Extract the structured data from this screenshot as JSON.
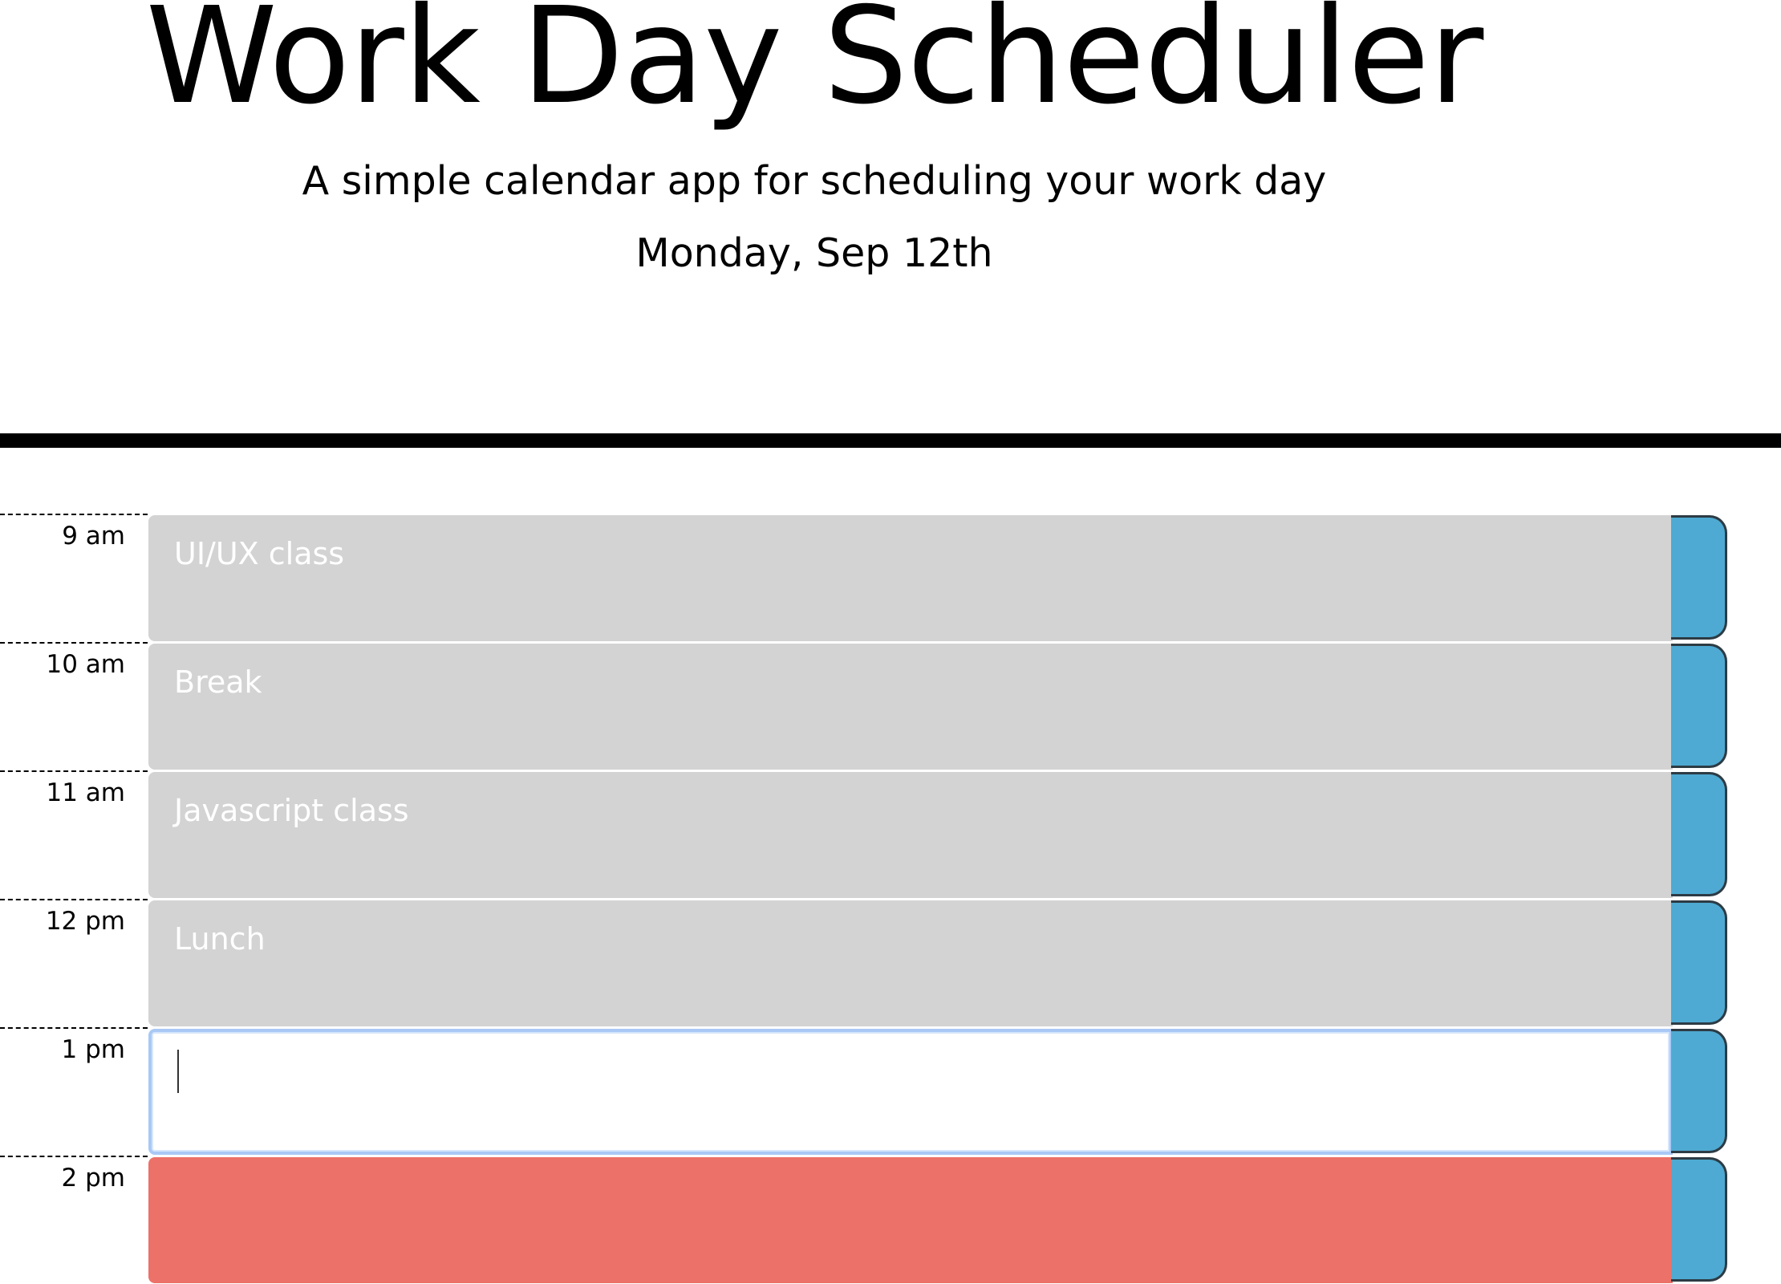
{
  "header": {
    "title": "Work Day Scheduler",
    "subtitle": "A simple calendar app for scheduling your work day",
    "current_day": "Monday, Sep 12th"
  },
  "timeblocks": [
    {
      "hour": "9 am",
      "text": "UI/UX class",
      "status": "past"
    },
    {
      "hour": "10 am",
      "text": "Break",
      "status": "past"
    },
    {
      "hour": "11 am",
      "text": "Javascript class",
      "status": "past"
    },
    {
      "hour": "12 pm",
      "text": "Lunch",
      "status": "past"
    },
    {
      "hour": "1 pm",
      "text": "",
      "status": "present"
    },
    {
      "hour": "2 pm",
      "text": "",
      "status": "future"
    }
  ],
  "colors": {
    "past": "#d3d3d3",
    "present": "#ffffff",
    "future": "#ec7168",
    "save_button": "#4eaad2"
  },
  "icons": {
    "save_button_icon": "save-icon"
  }
}
